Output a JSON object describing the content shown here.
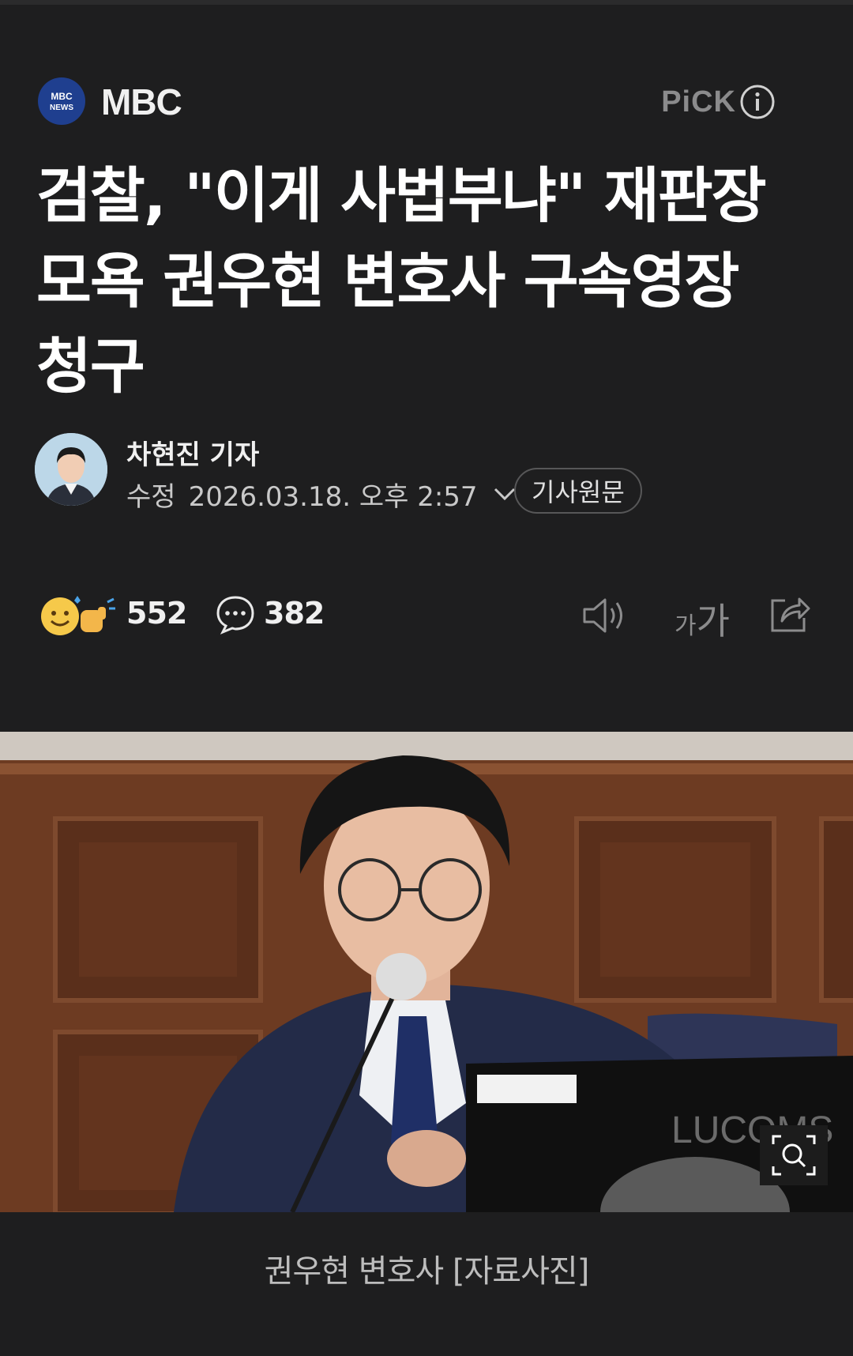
{
  "publisher": {
    "logo_text_top": "MBC",
    "logo_text_bottom": "NEWS",
    "name": "MBC",
    "pick_label": "PiCK",
    "info_icon": "info-icon"
  },
  "article": {
    "headline_lines": [
      "검찰, \"이게 사법부냐\" 재판장",
      "모욕 권우현 변호사 구속영장",
      "청구"
    ]
  },
  "reporter": {
    "name": "차현진 기자",
    "edit_label": "수정",
    "edit_datetime": "2026.03.18. 오후 2:57",
    "original_article_label": "기사원문"
  },
  "stats": {
    "reaction_count": "552",
    "comment_count": "382",
    "font_size_label_small": "가",
    "font_size_label_large": "가"
  },
  "photo": {
    "caption": "권우현 변호사 [자료사진]",
    "monitor_brand": "LUCOMS"
  },
  "colors": {
    "background": "#1e1e1f",
    "text": "#ffffff",
    "muted": "#8b8b8c",
    "mbc_blue": "#1f3f8f"
  }
}
